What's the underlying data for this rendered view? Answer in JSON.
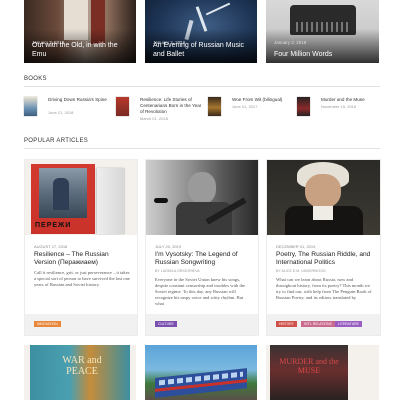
{
  "featured": [
    {
      "date": "January 2, 2019",
      "title": "Out with the Old, in with the Emu"
    },
    {
      "date": "January 2, 2019",
      "title": "An Evening of Russian Music and Ballet"
    },
    {
      "date": "January 2, 2019",
      "title": "Four Million Words"
    }
  ],
  "books_section": {
    "label": "BOOKS",
    "items": [
      {
        "title": "Driving Down Russia's Spine",
        "date": "June 21, 2018"
      },
      {
        "title": "Resilience: Life Stories of Centenarians Born in the Year of Revolution",
        "date": "March 01, 2018"
      },
      {
        "title": "Woe From Wit (bilingual)",
        "date": "June 01, 2017"
      },
      {
        "title": "Murder and the Muse",
        "date": "November 15, 2016"
      }
    ]
  },
  "popular_section": {
    "label": "POPULAR ARTICLES",
    "cards": [
      {
        "date": "AUGUST 17, 2018",
        "title": "Resilience – The Russian Version (Перажиаем)",
        "author": "",
        "excerpt": "Call it resilience, grit, or just perseverance – it takes a special sort of person to have survived the last one years of Russian and Soviet history.",
        "tags": [
          {
            "label": "INNOVATION",
            "color": "#e8873a"
          }
        ],
        "cover_text": "ПЕРЕЖИ"
      },
      {
        "date": "JULY 20, 2019",
        "title": "I'm Vysotsky: The Legend of Russian Songwriting",
        "author": "BY LUDMILA GRIGORIEVA",
        "excerpt": "Everyone in the Soviet Union knew his songs, despite constant censorship and troubles with the Soviet regime. To this day, any Russian will recognize his raspy voice and witty rhythm. But what",
        "tags": [
          {
            "label": "CULTURE",
            "color": "#7a4fb0"
          }
        ]
      },
      {
        "date": "DECEMBER 01, 2019",
        "title": "Poetry, The Russian Riddle, and International Politics",
        "author": "BY ALICE E.M. UNDERWOOD",
        "excerpt": "What can we learn about Russia, now and throughout history, from its poetry? This month we try to find out, with help from The Penguin Book of Russian Poetry, and its editors translated by",
        "tags": [
          {
            "label": "HISTORY",
            "color": "#d0524b"
          },
          {
            "label": "INT'L RELATIONS",
            "color": "#c96a8e"
          },
          {
            "label": "LITERATURE",
            "color": "#9a5ec3"
          }
        ]
      }
    ]
  },
  "bottom_row": [
    {
      "cover_text": "WAR and PEACE"
    },
    {
      "cover_text": ""
    },
    {
      "cover_text": "MURDER and the MUSE"
    }
  ]
}
